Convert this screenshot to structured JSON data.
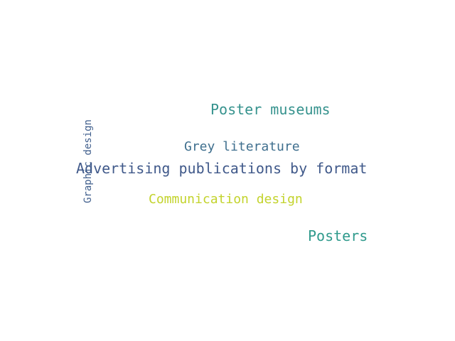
{
  "word_cloud": {
    "words": [
      {
        "id": "w-poster-museums",
        "text": "Poster museums",
        "color": "#35928d"
      },
      {
        "id": "w-grey-literature",
        "text": "Grey literature",
        "color": "#3f6f8e"
      },
      {
        "id": "w-advertising",
        "text": "Advertising publications by format",
        "color": "#40598a"
      },
      {
        "id": "w-communication",
        "text": "Communication design",
        "color": "#c3d32c"
      },
      {
        "id": "w-posters",
        "text": "Posters",
        "color": "#2f9a8c"
      },
      {
        "id": "w-graphic",
        "text": "Graphic design",
        "color": "#3f5e8c",
        "orientation": "vertical"
      }
    ]
  }
}
